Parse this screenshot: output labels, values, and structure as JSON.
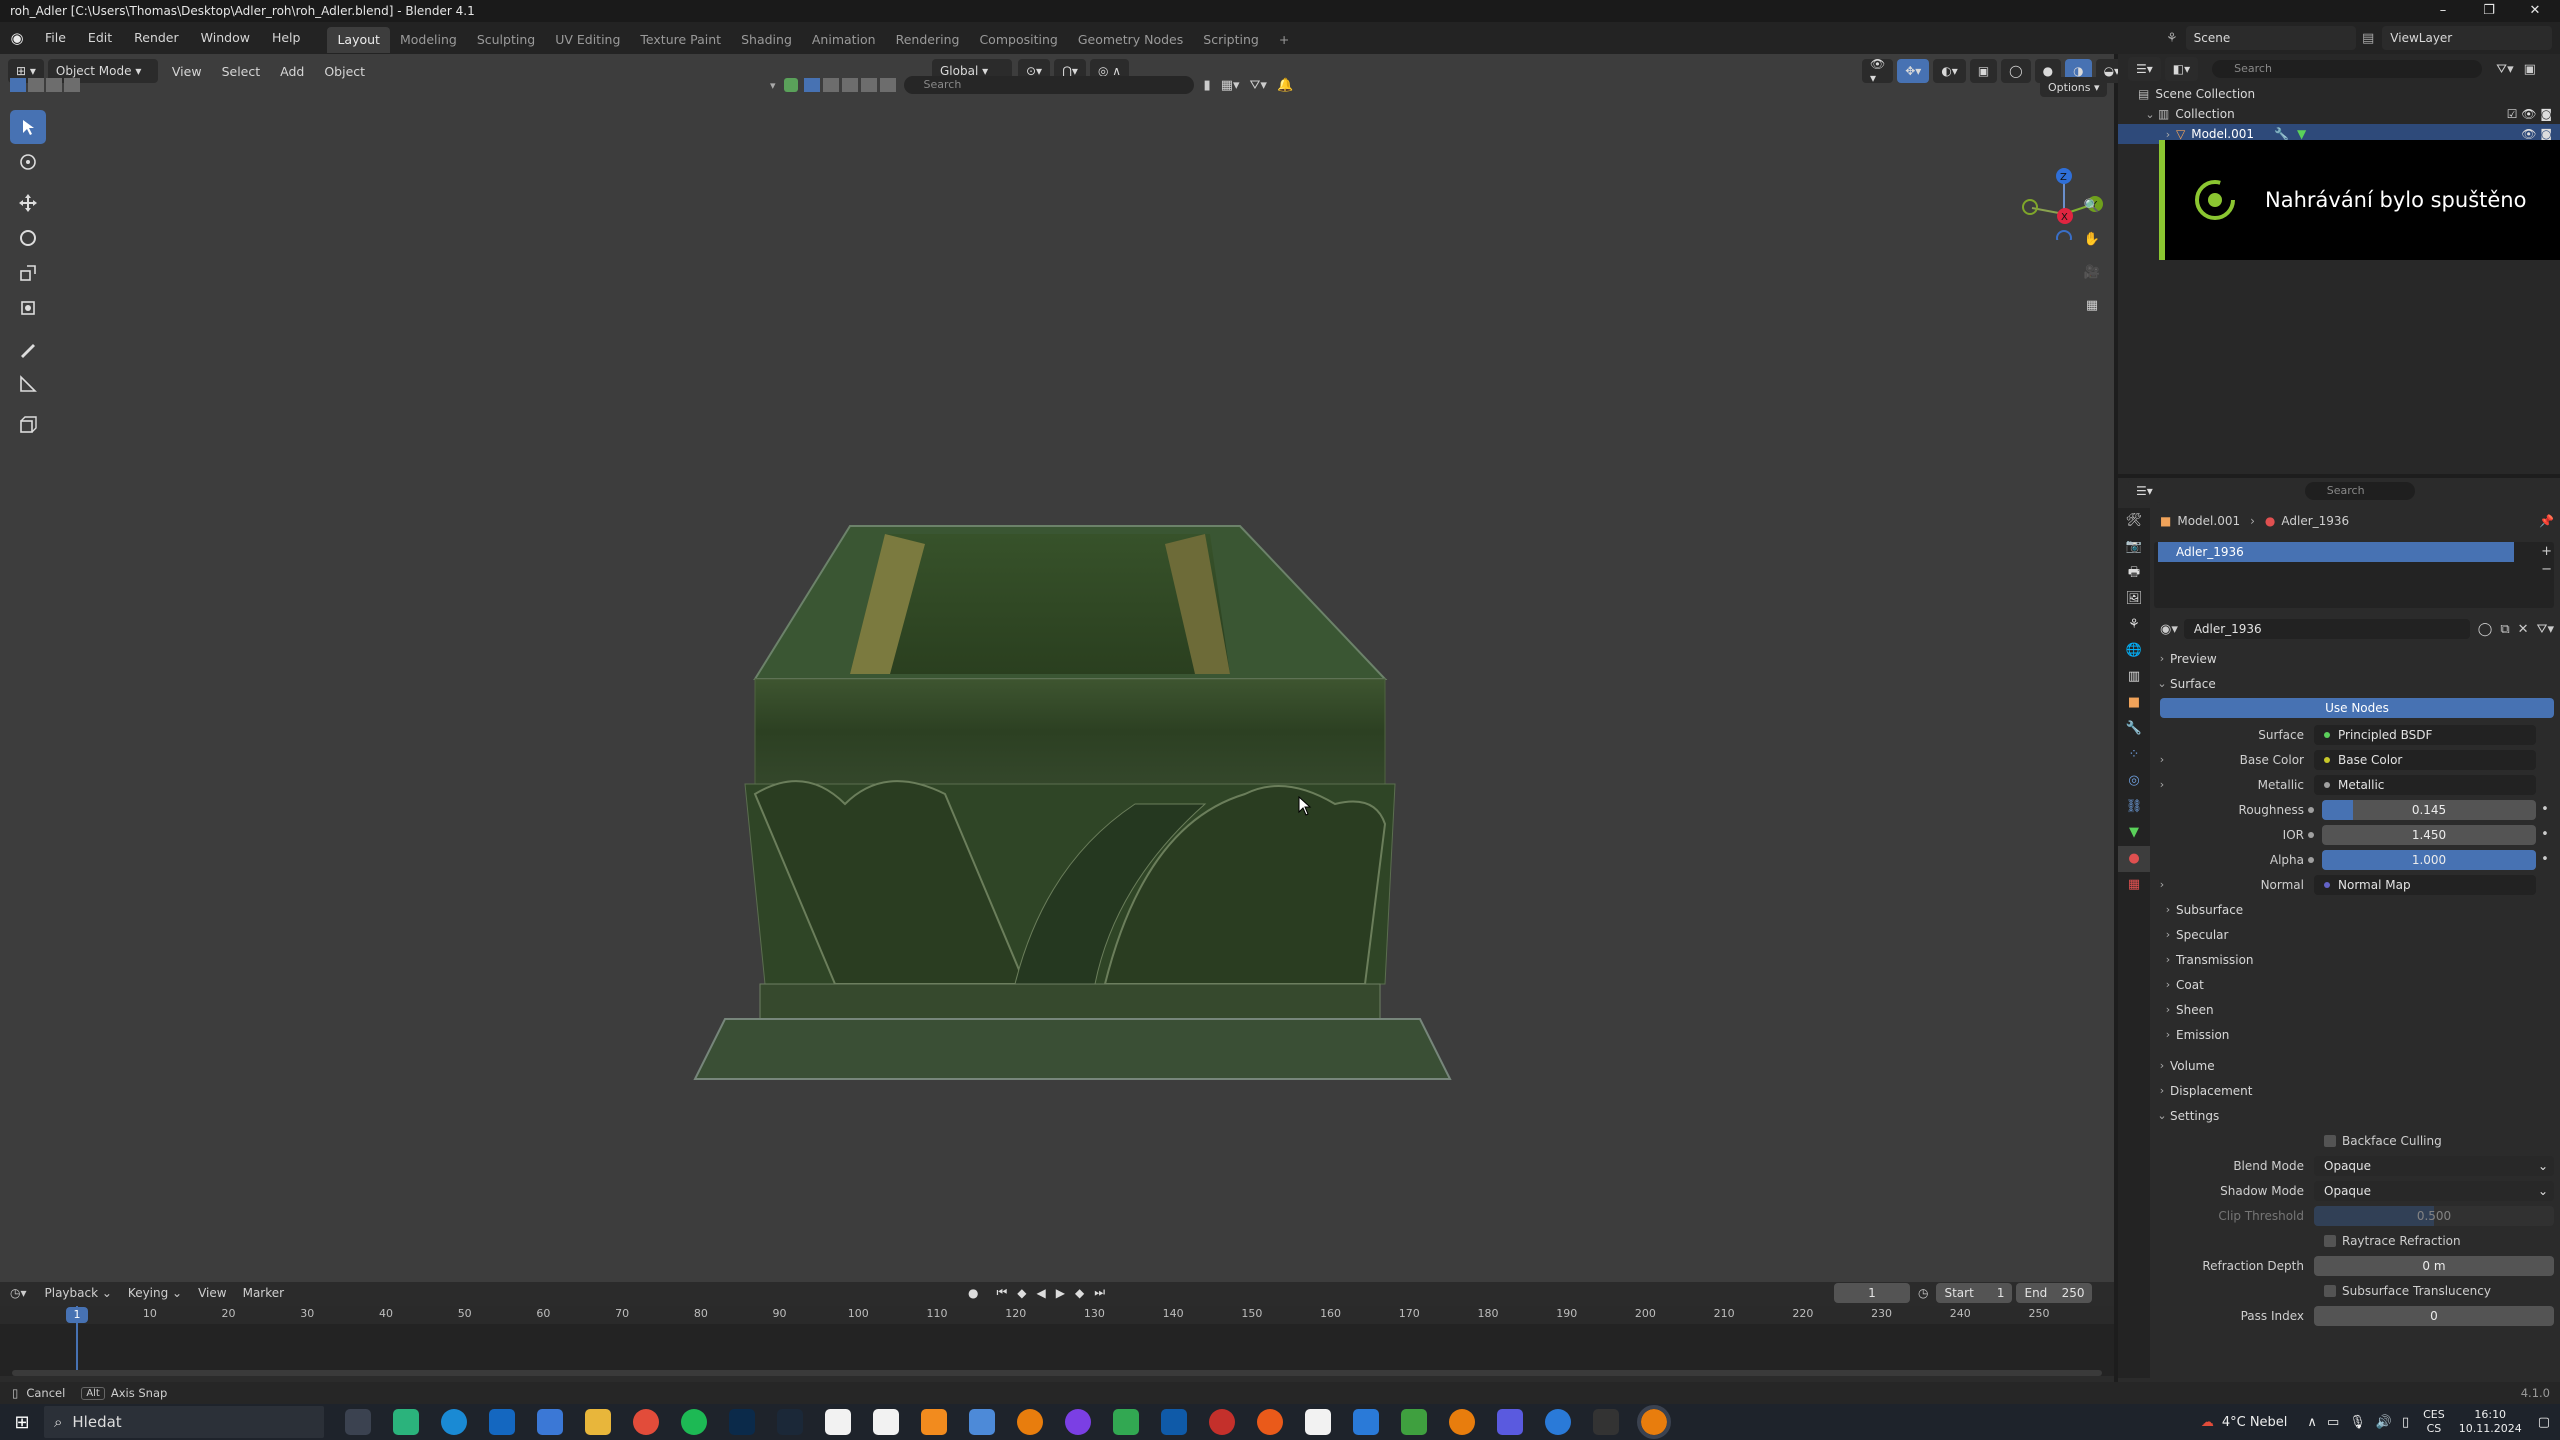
{
  "window": {
    "title": "roh_Adler [C:\\Users\\Thomas\\Desktop\\Adler_roh\\roh_Adler.blend] - Blender 4.1"
  },
  "menu": [
    "File",
    "Edit",
    "Render",
    "Window",
    "Help"
  ],
  "workspaces": [
    "Layout",
    "Modeling",
    "Sculpting",
    "UV Editing",
    "Texture Paint",
    "Shading",
    "Animation",
    "Rendering",
    "Compositing",
    "Geometry Nodes",
    "Scripting"
  ],
  "active_workspace": "Layout",
  "scene": {
    "name": "Scene",
    "view_layer": "ViewLayer",
    "search_placeholder": "Search"
  },
  "viewport": {
    "mode": "Object Mode",
    "menus": [
      "View",
      "Select",
      "Add",
      "Object"
    ],
    "orientation": "Global",
    "search_placeholder": "Search",
    "options_label": "Options",
    "gizmo": {
      "z": "Z",
      "y": "Y",
      "x": "X"
    }
  },
  "outliner": {
    "search_placeholder": "Search",
    "rows": [
      {
        "label": "Scene Collection"
      },
      {
        "label": "Collection"
      },
      {
        "label": "Model.001"
      }
    ]
  },
  "notification": {
    "text": "Nahrávání bylo spuštěno"
  },
  "properties": {
    "search_placeholder": "Search",
    "breadcrumb": {
      "object": "Model.001",
      "material": "Adler_1936"
    },
    "slot": "Adler_1936",
    "material_name": "Adler_1936",
    "sections": {
      "preview": "Preview",
      "surface": "Surface",
      "use_nodes": "Use Nodes",
      "volume": "Volume",
      "displacement": "Displacement",
      "settings": "Settings"
    },
    "surface_rows": [
      {
        "label": "Surface",
        "value": "Principled BSDF",
        "type": "link"
      },
      {
        "label": "Base Color",
        "value": "Base Color",
        "type": "link"
      },
      {
        "label": "Metallic",
        "value": "Metallic",
        "type": "link"
      },
      {
        "label": "Roughness",
        "value": "0.145",
        "type": "slider",
        "fill": 0.145
      },
      {
        "label": "IOR",
        "value": "1.450",
        "type": "slider",
        "fill": 0
      },
      {
        "label": "Alpha",
        "value": "1.000",
        "type": "slider",
        "fill": 1.0
      },
      {
        "label": "Normal",
        "value": "Normal Map",
        "type": "link"
      }
    ],
    "subpanels": [
      "Subsurface",
      "Specular",
      "Transmission",
      "Coat",
      "Sheen",
      "Emission"
    ],
    "settings": {
      "backface_culling": "Backface Culling",
      "blend_mode_label": "Blend Mode",
      "blend_mode": "Opaque",
      "shadow_mode_label": "Shadow Mode",
      "shadow_mode": "Opaque",
      "clip_threshold_label": "Clip Threshold",
      "clip_threshold": "0.500",
      "raytrace_refraction": "Raytrace Refraction",
      "refraction_depth_label": "Refraction Depth",
      "refraction_depth": "0 m",
      "subsurface_translucency": "Subsurface Translucency",
      "pass_index_label": "Pass Index",
      "pass_index": "0"
    }
  },
  "timeline": {
    "menus": [
      "Playback",
      "Keying",
      "View",
      "Marker"
    ],
    "current_frame": "1",
    "start_label": "Start",
    "start": "1",
    "end_label": "End",
    "end": "250",
    "ticks": [
      "1",
      "10",
      "20",
      "30",
      "40",
      "50",
      "60",
      "70",
      "80",
      "90",
      "100",
      "110",
      "120",
      "130",
      "140",
      "150",
      "160",
      "170",
      "180",
      "190",
      "200",
      "210",
      "220",
      "230",
      "240",
      "250"
    ]
  },
  "statusbar": {
    "cancel": "Cancel",
    "alt": "Alt",
    "axis_snap": "Axis Snap",
    "version": "4.1.0"
  },
  "taskbar": {
    "search": "Hledat",
    "weather": "4°C  Nebel",
    "lang": "CES",
    "lang2": "CS",
    "time": "16:10",
    "date": "10.11.2024"
  },
  "colors": {
    "accent": "#4772b3",
    "toast_bar": "#8bc631"
  }
}
